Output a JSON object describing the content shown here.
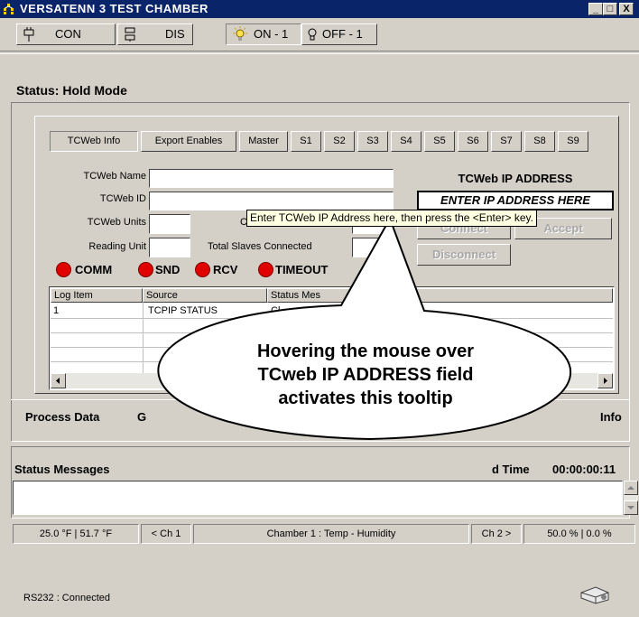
{
  "window": {
    "title": "VERSATENN 3 TEST CHAMBER",
    "minimize": "_",
    "maximize": "□",
    "close": "X"
  },
  "toolbar": {
    "connect": "CON",
    "disconnect": "DIS",
    "light_on": "ON - 1",
    "light_off": "OFF - 1"
  },
  "status": {
    "text": "Status:  Hold Mode"
  },
  "tabs": [
    "TCWeb Info",
    "Export Enables",
    "Master",
    "S1",
    "S2",
    "S3",
    "S4",
    "S5",
    "S6",
    "S7",
    "S8",
    "S9"
  ],
  "form": {
    "name_label": "TCWeb Name",
    "id_label": "TCWeb ID",
    "units_label": "TCWeb Units",
    "reading_label": "Reading Unit",
    "slaves_label": "Total Slaves Connected",
    "hidden_label_fragment": "C"
  },
  "ip": {
    "heading": "TCWeb IP ADDRESS",
    "value": "ENTER IP ADDRESS HERE",
    "connect": "Connect",
    "accept": "Accept",
    "disconnect": "Disconnect"
  },
  "indicators": [
    "COMM",
    "SND",
    "RCV",
    "TIMEOUT"
  ],
  "log": {
    "columns": [
      "Log Item",
      "Source",
      "Status Mes"
    ],
    "rows": [
      {
        "item": "1",
        "source": "TCPIP STATUS",
        "status": "Cl"
      }
    ]
  },
  "bottom_tabs": {
    "process_data": "Process Data",
    "g_fragment": "G",
    "info": "Info"
  },
  "status_messages": {
    "label": "Status Messages",
    "time_label": "d Time",
    "time_value": "00:00:00:11"
  },
  "status_bar": {
    "temps": "25.0 °F  |  51.7 °F",
    "prev": "< Ch 1",
    "chamber": "Chamber 1 : Temp - Humidity",
    "next": "Ch 2 >",
    "humid": "50.0 %  |  0.0 %"
  },
  "footer": {
    "connection": "RS232 : Connected"
  },
  "tooltip": {
    "text": "Enter TCWeb IP Address here, then press the <Enter> key."
  },
  "callout": {
    "line1": "Hovering the mouse over",
    "line2": "TCweb IP ADDRESS field",
    "line3": "activates this tooltip"
  },
  "colors": {
    "titlebar": "#0a246a",
    "led_red": "#e00000",
    "tooltip_bg": "#ffffe1",
    "face": "#d4d0c8"
  }
}
